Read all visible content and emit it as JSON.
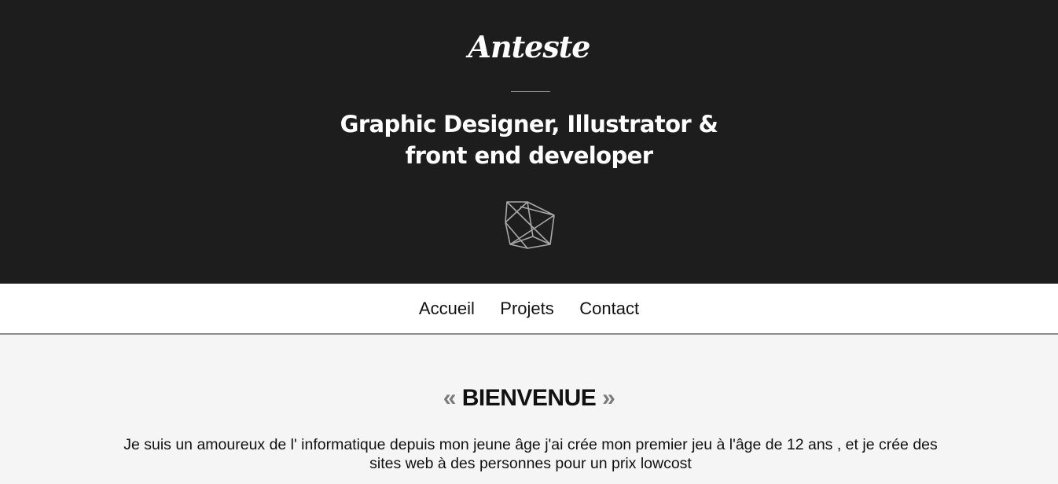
{
  "header": {
    "logo_text": "Anteste",
    "tagline_line1": "Graphic Designer, Illustrator &",
    "tagline_line2": "front end developer",
    "background": "#1d1d1d",
    "icon": "geometric-polygon-icon"
  },
  "nav": {
    "items": [
      {
        "label": "Accueil"
      },
      {
        "label": "Projets"
      },
      {
        "label": "Contact"
      }
    ]
  },
  "main": {
    "quote_open": "«",
    "title": "BIENVENUE",
    "quote_close": "»",
    "intro": "Je suis un amoureux de l' informatique depuis mon jeune âge j'ai crée mon premier jeu à l'âge de 12 ans , et je crée des sites web à des personnes pour un prix lowcost",
    "background": "#f4f5f4"
  }
}
